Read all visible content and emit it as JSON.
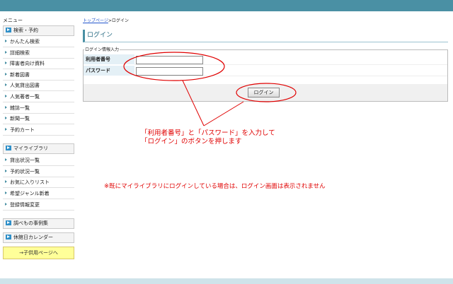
{
  "menu": {
    "title": "メニュー",
    "groups": [
      {
        "label": "検索・予約"
      },
      {
        "label": "マイライブラリ"
      },
      {
        "label": "調べもの事例集"
      },
      {
        "label": "休館日カレンダー"
      }
    ],
    "search_items": [
      "かんたん検索",
      "詳細検索",
      "障害者向け資料",
      "新着図書",
      "人気貸出図書",
      "人気著者一覧",
      "雑誌一覧",
      "新聞一覧",
      "予約カート"
    ],
    "library_items": [
      "貸出状況一覧",
      "予約状況一覧",
      "お気に入りリスト",
      "希望ジャンル新着",
      "登録情報変更"
    ],
    "kids_button": "→子供用ページへ"
  },
  "breadcrumb": {
    "home": "トップページ",
    "separator": ">",
    "current": "ログイン"
  },
  "page_title": "ログイン",
  "form": {
    "legend": "ログイン情報入力",
    "user_label": "利用者番号",
    "password_label": "パスワード",
    "user_value": "",
    "password_value": "",
    "submit_label": "ログイン"
  },
  "annotation": {
    "line1": "「利用者番号」と「パスワード」を入力して",
    "line2": "「ログイン」のボタンを押します",
    "note": "※既にマイライブラリにログインしている場合は、ログイン画面は表示されません"
  },
  "colors": {
    "header": "#4a90a4",
    "accent_icon": "#2f8fc8",
    "annotation": "#e00000",
    "kids_button": "#ffff99"
  }
}
